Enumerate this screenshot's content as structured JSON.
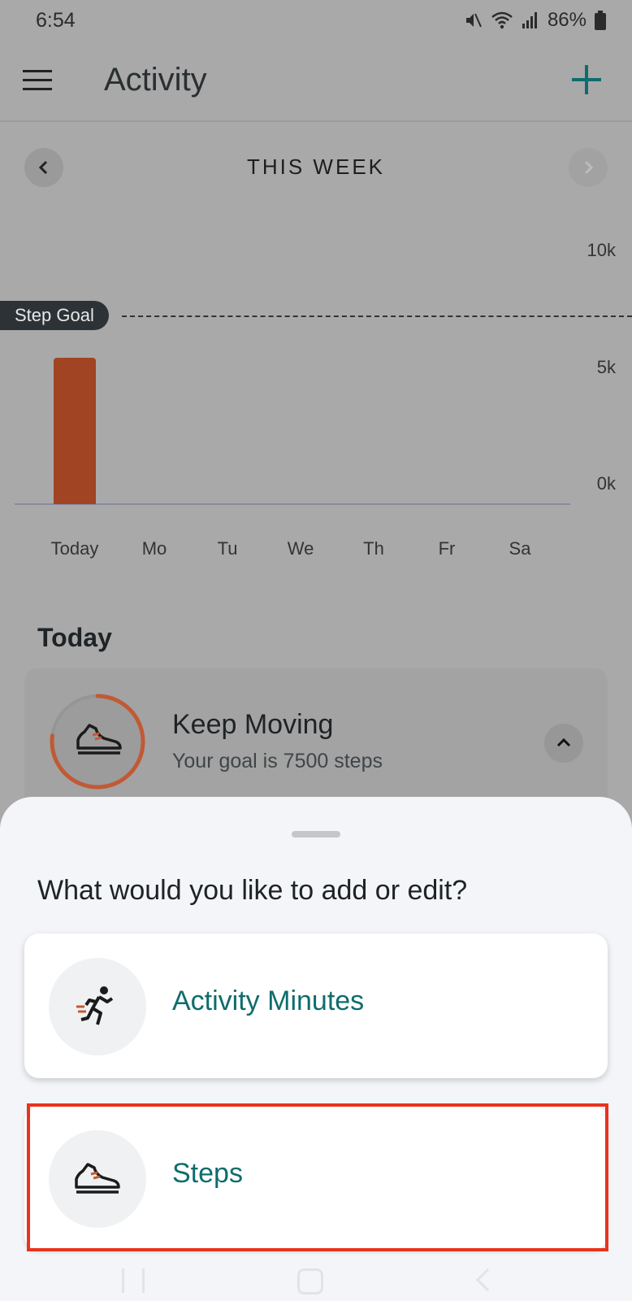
{
  "status_bar": {
    "time": "6:54",
    "battery": "86%",
    "icons": [
      "mute-icon",
      "wifi-icon",
      "signal-icon",
      "battery-icon"
    ]
  },
  "app_bar": {
    "title": "Activity",
    "menu_icon": "menu-icon",
    "add_icon": "plus-icon"
  },
  "week_nav": {
    "label": "THIS WEEK",
    "prev_icon": "chevron-left-icon",
    "next_icon": "chevron-right-icon"
  },
  "chart_data": {
    "type": "bar",
    "title": "",
    "categories": [
      "Today",
      "Mo",
      "Tu",
      "We",
      "Th",
      "Fr",
      "Sa"
    ],
    "values": [
      5800,
      0,
      0,
      0,
      0,
      0,
      0
    ],
    "ylim": [
      0,
      10000
    ],
    "y_ticks": [
      "10k",
      "5k",
      "0k"
    ],
    "y_tick_values": [
      10000,
      5000,
      0
    ],
    "goal": 7500,
    "goal_label": "Step Goal",
    "bar_color": "#a04423",
    "grid": false
  },
  "today": {
    "heading": "Today",
    "card": {
      "title": "Keep Moving",
      "subtitle": "Your goal is 7500 steps",
      "icon": "shoe-icon",
      "ring_progress": 0.77,
      "ring_color": "#c05a35"
    }
  },
  "sheet": {
    "title": "What would you like to add or edit?",
    "options": [
      {
        "label": "Activity Minutes",
        "icon": "running-person-icon"
      },
      {
        "label": "Steps",
        "icon": "shoe-icon"
      }
    ]
  },
  "colors": {
    "accent": "#0f6c6c",
    "highlight": "#e8341c"
  }
}
